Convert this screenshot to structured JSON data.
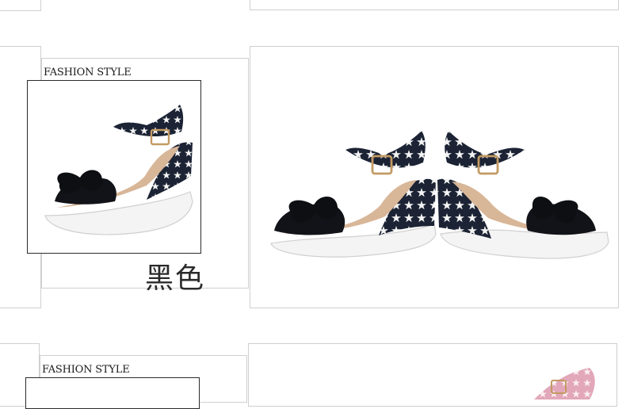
{
  "sections": [
    {
      "label": "FASHION STYLE",
      "color_name": "黑色",
      "color_swatch": "#1f2a3a"
    },
    {
      "label": "FASHION STYLE",
      "color_name": "",
      "color_swatch": "#e7b7c4"
    }
  ],
  "palette": {
    "navy": "#1b2334",
    "white": "#ffffff",
    "black_leather": "#121318",
    "sole": "#f2f2f2",
    "buckle": "#c39a63",
    "inner": "#d8b698",
    "pink": "#e2a7b9"
  }
}
